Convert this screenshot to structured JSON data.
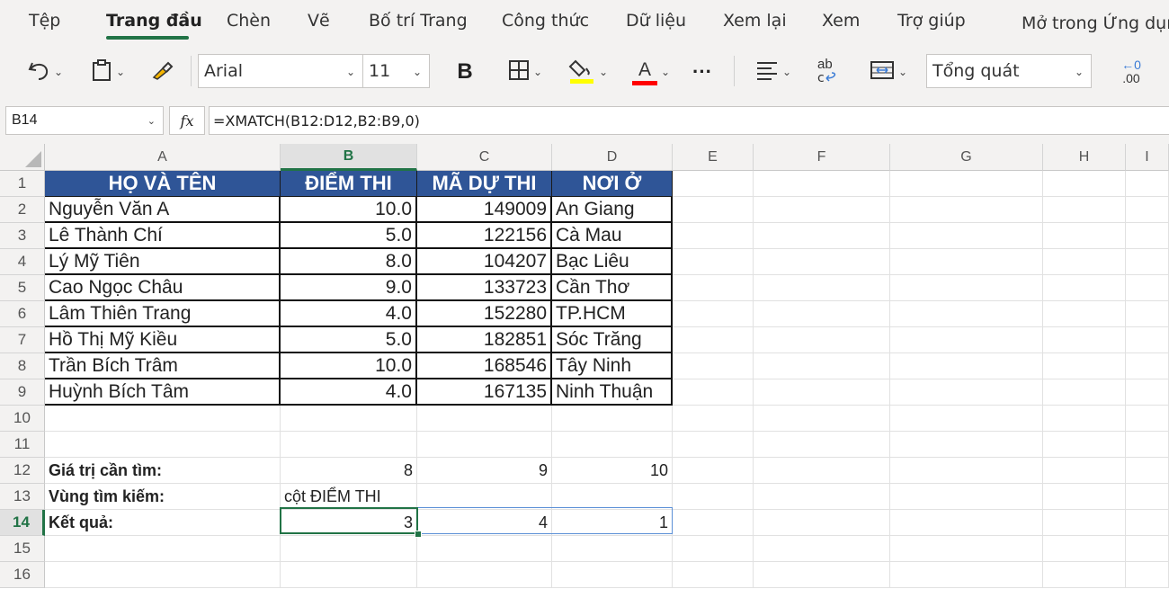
{
  "ribbon": {
    "tabs": [
      "Tệp",
      "Trang đầu",
      "Chèn",
      "Vẽ",
      "Bố trí Trang",
      "Công thức",
      "Dữ liệu",
      "Xem lại",
      "Xem",
      "Trợ giúp",
      "Mở trong Ứng dụng"
    ],
    "active_tab": "Trang đầu"
  },
  "toolbar": {
    "font_name": "Arial",
    "font_size": "11",
    "bold_label": "B",
    "font_color_label": "A",
    "more_label": "···",
    "number_format": "Tổng quát",
    "wrap_label": "ab",
    "decimal_label_top": "←0",
    "decimal_label_bottom": ".00",
    "fill_color": "#ffff00",
    "font_color": "#ff0000"
  },
  "formula_bar": {
    "name_box": "B14",
    "fx_label": "fx",
    "formula": "=XMATCH(B12:D12,B2:B9,0)"
  },
  "grid": {
    "columns": [
      "A",
      "B",
      "C",
      "D",
      "E",
      "F",
      "G",
      "H",
      "I"
    ],
    "selected_column": "B",
    "rows": [
      "1",
      "2",
      "3",
      "4",
      "5",
      "6",
      "7",
      "8",
      "9",
      "10",
      "11",
      "12",
      "13",
      "14",
      "15",
      "16"
    ],
    "selected_row": "14",
    "header_fill": "#2f5597",
    "headers": [
      "HỌ VÀ TÊN",
      "ĐIỂM THI",
      "MÃ DỰ THI",
      "NƠI Ở"
    ],
    "records": [
      [
        "Nguyễn Văn A",
        "10.0",
        "149009",
        "An Giang"
      ],
      [
        "Lê Thành Chí",
        "5.0",
        "122156",
        "Cà Mau"
      ],
      [
        "Lý Mỹ Tiên",
        "8.0",
        "104207",
        "Bạc Liêu"
      ],
      [
        "Cao Ngọc Châu",
        "9.0",
        "133723",
        "Cần Thơ"
      ],
      [
        "Lâm Thiên Trang",
        "4.0",
        "152280",
        "TP.HCM"
      ],
      [
        "Hồ Thị Mỹ Kiều",
        "5.0",
        "182851",
        "Sóc Trăng"
      ],
      [
        "Trần Bích Trâm",
        "10.0",
        "168546",
        "Tây Ninh"
      ],
      [
        "Huỳnh Bích Tâm",
        "4.0",
        "167135",
        "Ninh Thuận"
      ]
    ],
    "lookup": {
      "label": "Giá trị cần tìm:",
      "values": [
        "8",
        "9",
        "10"
      ]
    },
    "range": {
      "label": "Vùng tìm kiếm:",
      "value": "cột ĐIỂM THI"
    },
    "result": {
      "label": "Kết quả:",
      "values": [
        "3",
        "4",
        "1"
      ]
    }
  }
}
